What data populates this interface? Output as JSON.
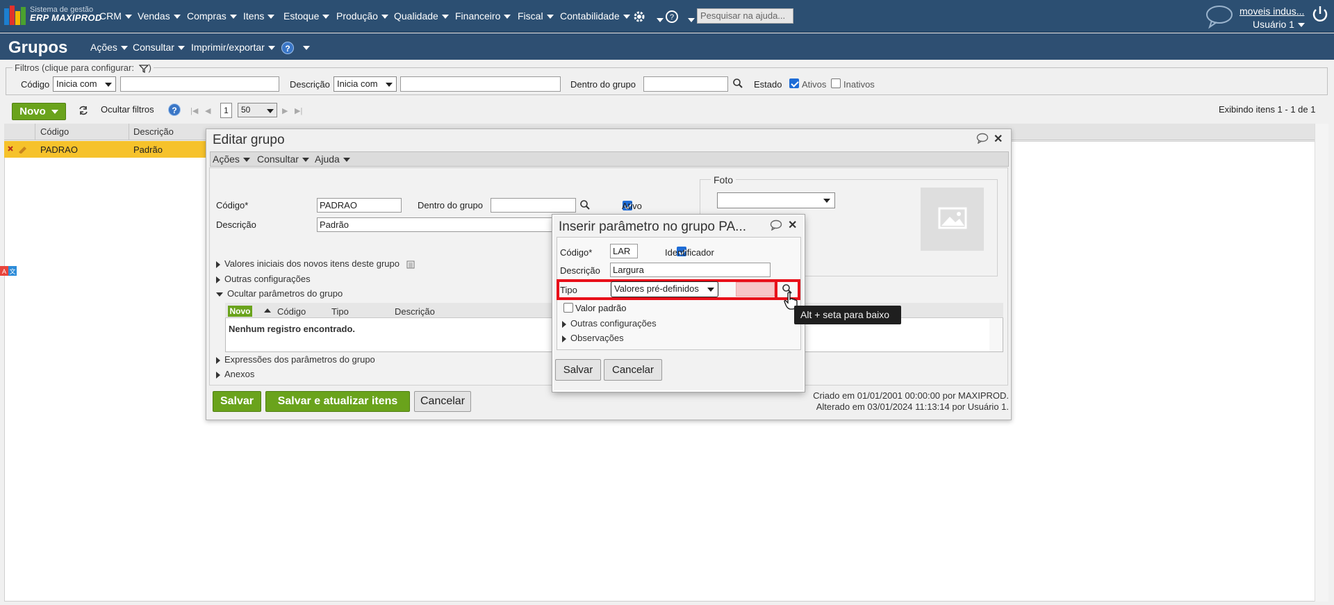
{
  "topnav": {
    "logo_line1": "Sistema de gestão",
    "logo_line2": "ERP MAXIPROD",
    "menus": [
      "CRM",
      "Vendas",
      "Compras",
      "Itens",
      "Estoque",
      "Produção",
      "Qualidade",
      "Financeiro",
      "Fiscal",
      "Contabilidade"
    ],
    "search_placeholder": "Pesquisar na ajuda...",
    "company": "moveis indus...",
    "user": "Usuário 1"
  },
  "page": {
    "title": "Grupos",
    "menus": [
      "Ações",
      "Consultar",
      "Imprimir/exportar"
    ],
    "help": "?"
  },
  "filters": {
    "legend": "Filtros (clique para configurar:",
    "codigo_label": "Código",
    "codigo_mode": "Inicia com",
    "descricao_label": "Descrição",
    "descricao_mode": "Inicia com",
    "dentro_label": "Dentro do grupo",
    "estado_label": "Estado",
    "ativos": "Ativos",
    "inativos": "Inativos"
  },
  "toolbar": {
    "novo": "Novo",
    "ocultar": "Ocultar filtros",
    "page": "1",
    "per_page": "50",
    "exibindo": "Exibindo itens 1 - 1 de 1"
  },
  "grid": {
    "columns": [
      "Código",
      "Descrição"
    ],
    "row": {
      "codigo": "PADRAO",
      "descricao": "Padrão"
    }
  },
  "edit_dialog": {
    "title": "Editar grupo",
    "menus": [
      "Ações",
      "Consultar",
      "Ajuda"
    ],
    "codigo_label": "Código*",
    "codigo_value": "PADRAO",
    "dentro_label": "Dentro do grupo",
    "ativo": "Ativo",
    "descricao_label": "Descrição",
    "descricao_value": "Padrão",
    "foto": "Foto",
    "sections": [
      "Valores iniciais dos novos itens deste grupo",
      "Outras configurações",
      "Ocultar parâmetros do grupo"
    ],
    "param_grid": {
      "novo": "Novo",
      "columns": [
        "Código",
        "Tipo",
        "Descrição"
      ],
      "empty": "Nenhum registro encontrado."
    },
    "sections_bottom": [
      "Expressões dos parâmetros do grupo",
      "Anexos"
    ],
    "salvar": "Salvar",
    "salvar_atualizar": "Salvar e atualizar itens",
    "cancelar": "Cancelar",
    "criado": "Criado em 01/01/2001 00:00:00 por MAXIPROD.",
    "alterado": "Alterado em 03/01/2024 11:13:14 por Usuário 1."
  },
  "param_dialog": {
    "title": "Inserir parâmetro no grupo PA...",
    "codigo_label": "Código*",
    "codigo_value": "LAR",
    "identificador": "Identificador",
    "descricao_label": "Descrição",
    "descricao_value": "Largura",
    "tipo_label": "Tipo",
    "tipo_value": "Valores pré-definidos",
    "valor_padrao": "Valor padrão",
    "outras": "Outras configurações",
    "observacoes": "Observações",
    "salvar": "Salvar",
    "cancelar": "Cancelar"
  },
  "tooltip": "Alt + seta para baixo",
  "colors": {
    "nav": "#2c4f72",
    "green": "#6aa31c",
    "row": "#f6c22b",
    "highlight": "#e8101a"
  }
}
